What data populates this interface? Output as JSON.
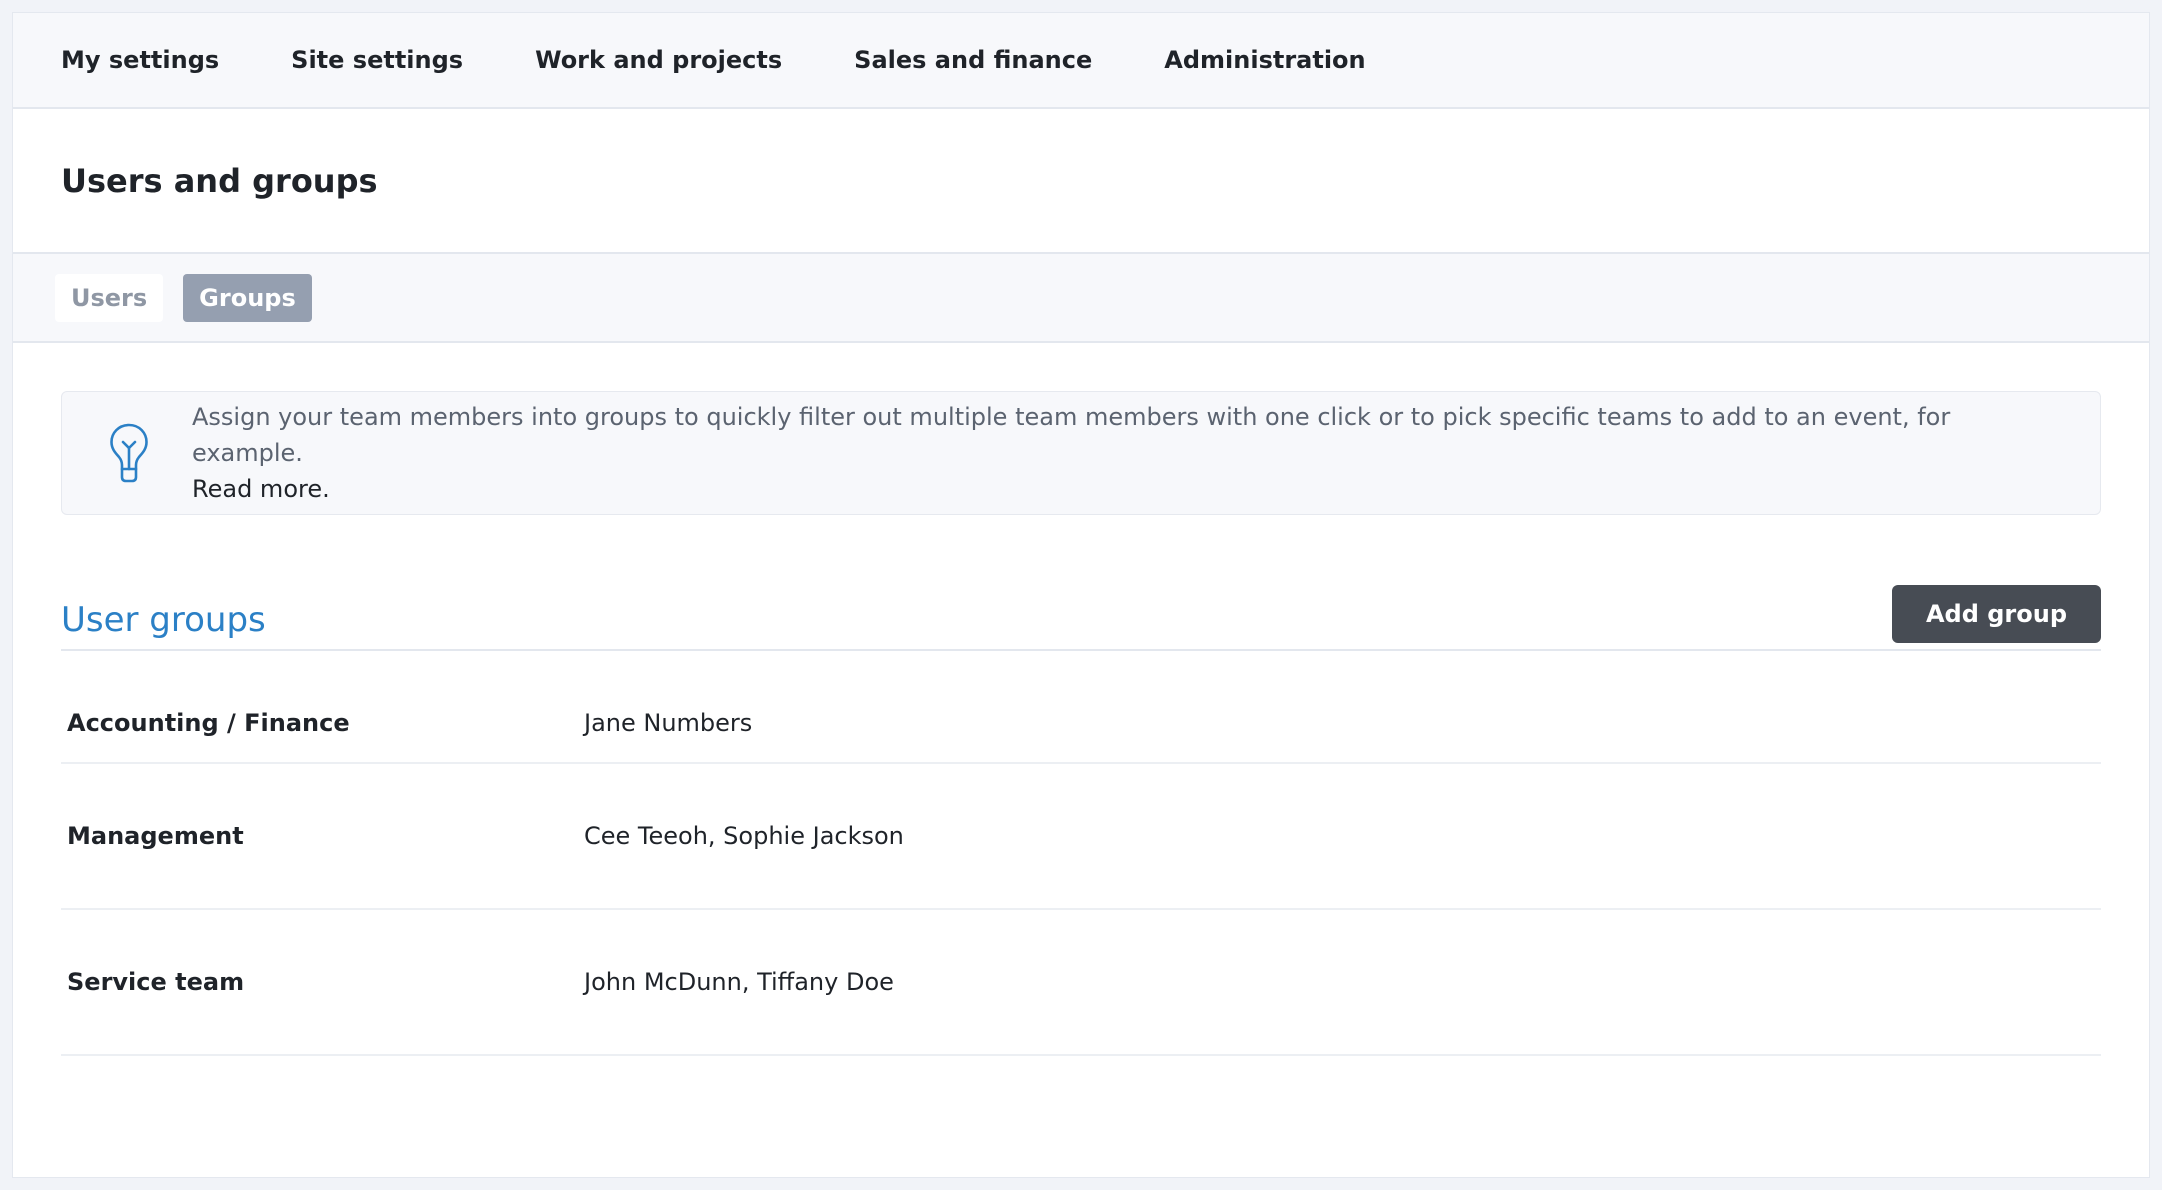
{
  "topnav": {
    "items": [
      {
        "label": "My settings"
      },
      {
        "label": "Site settings"
      },
      {
        "label": "Work and projects"
      },
      {
        "label": "Sales and finance"
      },
      {
        "label": "Administration"
      }
    ]
  },
  "page": {
    "title": "Users and groups"
  },
  "subtabs": {
    "users": "Users",
    "groups": "Groups",
    "active": "Groups"
  },
  "info": {
    "icon": "lightbulb-icon",
    "text": "Assign your team members into groups to quickly filter out multiple team members with one click or to pick specific teams to add to an event, for example.",
    "read_more": "Read more."
  },
  "groups_section": {
    "title": "User groups",
    "add_button": "Add group"
  },
  "groups": {
    "rows": [
      {
        "name": "Accounting / Finance",
        "members": "Jane Numbers"
      },
      {
        "name": "Management",
        "members": "Cee Teeoh, Sophie Jackson"
      },
      {
        "name": "Service team",
        "members": "John McDunn, Tiffany Doe"
      }
    ]
  },
  "colors": {
    "accent": "#2b80c6",
    "button_dark": "#474c54",
    "active_tab": "#959fb0"
  }
}
